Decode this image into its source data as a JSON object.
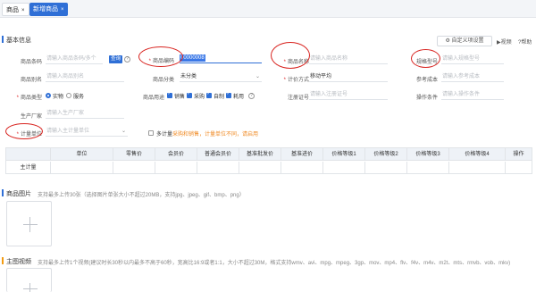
{
  "tabs": [
    {
      "label": "商品",
      "close": "×"
    },
    {
      "label": "新增商品",
      "close": "×"
    }
  ],
  "section_basic": {
    "title": "基本信息",
    "custom_button": "自定义项设置",
    "video_link": "视频",
    "help_link": "帮助"
  },
  "form": {
    "barcode_label": "商品条码",
    "barcode_placeholder": "请输入商品条码/多个",
    "barcode_button": "查询",
    "code_label": "商品编码",
    "code_value": "00000008",
    "name_label": "商品名称",
    "name_placeholder": "请输入商品名称",
    "spec_label": "规格型号",
    "spec_placeholder": "请输入规格型号",
    "alias_label": "商品别名",
    "alias_placeholder": "请输入商品别名",
    "category_label": "商品分类",
    "category_value": "未分类",
    "costing_label": "计价方式",
    "costing_value": "移动平均",
    "ref_cost_label": "参考成本",
    "ref_cost_placeholder": "请输入参考成本",
    "type_label": "商品类型",
    "type_options": [
      "实物",
      "服务"
    ],
    "usage_label": "商品用途",
    "usage_options": [
      "销售",
      "采购",
      "自制",
      "耗用"
    ],
    "reg_label": "注册证号",
    "reg_placeholder": "请输入注册证号",
    "op_label": "操作条件",
    "op_placeholder": "请输入操作条件",
    "mfr_label": "生产厂家",
    "mfr_placeholder": "请输入生产厂家",
    "unit_label": "计量单位",
    "unit_placeholder": "请输入主计量单位",
    "multi_unit_label": "多计量",
    "multi_unit_warning": "采购和销售，计量单位不同，请启用"
  },
  "price_table": {
    "headers": [
      "单位",
      "零售价",
      "会员价",
      "普通会员价",
      "基准批发价",
      "基准进价",
      "价格等级1",
      "价格等级2",
      "价格等级3",
      "价格等级4",
      "操作"
    ],
    "rows": [
      {
        "name": "主计量"
      }
    ]
  },
  "section_images": {
    "title": "商品图片",
    "hint": "支持最多上传30张（选择图片单张大小不超过20MB，支持jpg、jpeg、gif、bmp、png）"
  },
  "section_video": {
    "title": "主图视频",
    "hint": "支持最多上传1个视频(建议时长30秒以内最多不高于60秒，宽高比16:9或者1:1，大小不超过30M，格式支持wmv、avi、mpg、mpeg、3gp、mov、mp4、flv、f4v、m4v、m2t、mts、rmvb、vob、mkv)"
  },
  "icons": [
    "close-icon",
    "question-icon",
    "chevron-down-icon",
    "gear-icon",
    "video-icon",
    "help-icon",
    "plus-icon",
    "checkbox-icon",
    "radio-icon"
  ],
  "colors": {
    "accent": "#2f6fd6",
    "required": "#e0292b",
    "warning": "#f08a24",
    "annotation": "#d8231f"
  }
}
